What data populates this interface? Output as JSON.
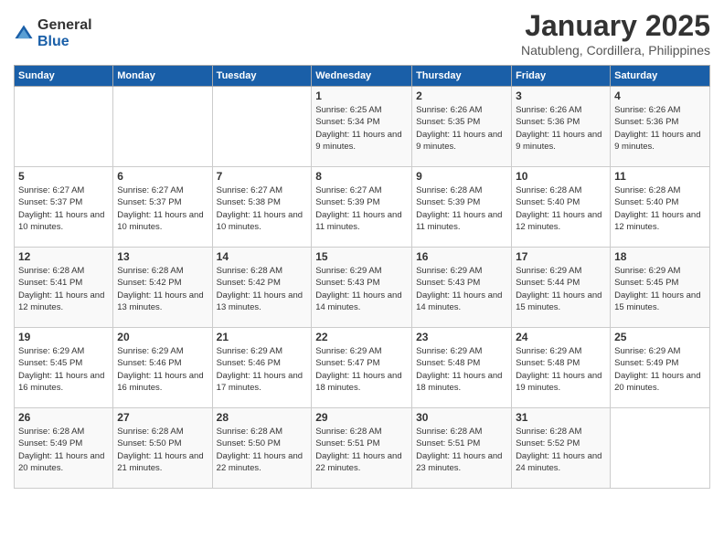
{
  "header": {
    "logo_general": "General",
    "logo_blue": "Blue",
    "month_title": "January 2025",
    "location": "Natubleng, Cordillera, Philippines"
  },
  "calendar": {
    "days_of_week": [
      "Sunday",
      "Monday",
      "Tuesday",
      "Wednesday",
      "Thursday",
      "Friday",
      "Saturday"
    ],
    "weeks": [
      [
        {
          "day": "",
          "info": ""
        },
        {
          "day": "",
          "info": ""
        },
        {
          "day": "",
          "info": ""
        },
        {
          "day": "1",
          "info": "Sunrise: 6:25 AM\nSunset: 5:34 PM\nDaylight: 11 hours and 9 minutes."
        },
        {
          "day": "2",
          "info": "Sunrise: 6:26 AM\nSunset: 5:35 PM\nDaylight: 11 hours and 9 minutes."
        },
        {
          "day": "3",
          "info": "Sunrise: 6:26 AM\nSunset: 5:36 PM\nDaylight: 11 hours and 9 minutes."
        },
        {
          "day": "4",
          "info": "Sunrise: 6:26 AM\nSunset: 5:36 PM\nDaylight: 11 hours and 9 minutes."
        }
      ],
      [
        {
          "day": "5",
          "info": "Sunrise: 6:27 AM\nSunset: 5:37 PM\nDaylight: 11 hours and 10 minutes."
        },
        {
          "day": "6",
          "info": "Sunrise: 6:27 AM\nSunset: 5:37 PM\nDaylight: 11 hours and 10 minutes."
        },
        {
          "day": "7",
          "info": "Sunrise: 6:27 AM\nSunset: 5:38 PM\nDaylight: 11 hours and 10 minutes."
        },
        {
          "day": "8",
          "info": "Sunrise: 6:27 AM\nSunset: 5:39 PM\nDaylight: 11 hours and 11 minutes."
        },
        {
          "day": "9",
          "info": "Sunrise: 6:28 AM\nSunset: 5:39 PM\nDaylight: 11 hours and 11 minutes."
        },
        {
          "day": "10",
          "info": "Sunrise: 6:28 AM\nSunset: 5:40 PM\nDaylight: 11 hours and 12 minutes."
        },
        {
          "day": "11",
          "info": "Sunrise: 6:28 AM\nSunset: 5:40 PM\nDaylight: 11 hours and 12 minutes."
        }
      ],
      [
        {
          "day": "12",
          "info": "Sunrise: 6:28 AM\nSunset: 5:41 PM\nDaylight: 11 hours and 12 minutes."
        },
        {
          "day": "13",
          "info": "Sunrise: 6:28 AM\nSunset: 5:42 PM\nDaylight: 11 hours and 13 minutes."
        },
        {
          "day": "14",
          "info": "Sunrise: 6:28 AM\nSunset: 5:42 PM\nDaylight: 11 hours and 13 minutes."
        },
        {
          "day": "15",
          "info": "Sunrise: 6:29 AM\nSunset: 5:43 PM\nDaylight: 11 hours and 14 minutes."
        },
        {
          "day": "16",
          "info": "Sunrise: 6:29 AM\nSunset: 5:43 PM\nDaylight: 11 hours and 14 minutes."
        },
        {
          "day": "17",
          "info": "Sunrise: 6:29 AM\nSunset: 5:44 PM\nDaylight: 11 hours and 15 minutes."
        },
        {
          "day": "18",
          "info": "Sunrise: 6:29 AM\nSunset: 5:45 PM\nDaylight: 11 hours and 15 minutes."
        }
      ],
      [
        {
          "day": "19",
          "info": "Sunrise: 6:29 AM\nSunset: 5:45 PM\nDaylight: 11 hours and 16 minutes."
        },
        {
          "day": "20",
          "info": "Sunrise: 6:29 AM\nSunset: 5:46 PM\nDaylight: 11 hours and 16 minutes."
        },
        {
          "day": "21",
          "info": "Sunrise: 6:29 AM\nSunset: 5:46 PM\nDaylight: 11 hours and 17 minutes."
        },
        {
          "day": "22",
          "info": "Sunrise: 6:29 AM\nSunset: 5:47 PM\nDaylight: 11 hours and 18 minutes."
        },
        {
          "day": "23",
          "info": "Sunrise: 6:29 AM\nSunset: 5:48 PM\nDaylight: 11 hours and 18 minutes."
        },
        {
          "day": "24",
          "info": "Sunrise: 6:29 AM\nSunset: 5:48 PM\nDaylight: 11 hours and 19 minutes."
        },
        {
          "day": "25",
          "info": "Sunrise: 6:29 AM\nSunset: 5:49 PM\nDaylight: 11 hours and 20 minutes."
        }
      ],
      [
        {
          "day": "26",
          "info": "Sunrise: 6:28 AM\nSunset: 5:49 PM\nDaylight: 11 hours and 20 minutes."
        },
        {
          "day": "27",
          "info": "Sunrise: 6:28 AM\nSunset: 5:50 PM\nDaylight: 11 hours and 21 minutes."
        },
        {
          "day": "28",
          "info": "Sunrise: 6:28 AM\nSunset: 5:50 PM\nDaylight: 11 hours and 22 minutes."
        },
        {
          "day": "29",
          "info": "Sunrise: 6:28 AM\nSunset: 5:51 PM\nDaylight: 11 hours and 22 minutes."
        },
        {
          "day": "30",
          "info": "Sunrise: 6:28 AM\nSunset: 5:51 PM\nDaylight: 11 hours and 23 minutes."
        },
        {
          "day": "31",
          "info": "Sunrise: 6:28 AM\nSunset: 5:52 PM\nDaylight: 11 hours and 24 minutes."
        },
        {
          "day": "",
          "info": ""
        }
      ]
    ]
  }
}
